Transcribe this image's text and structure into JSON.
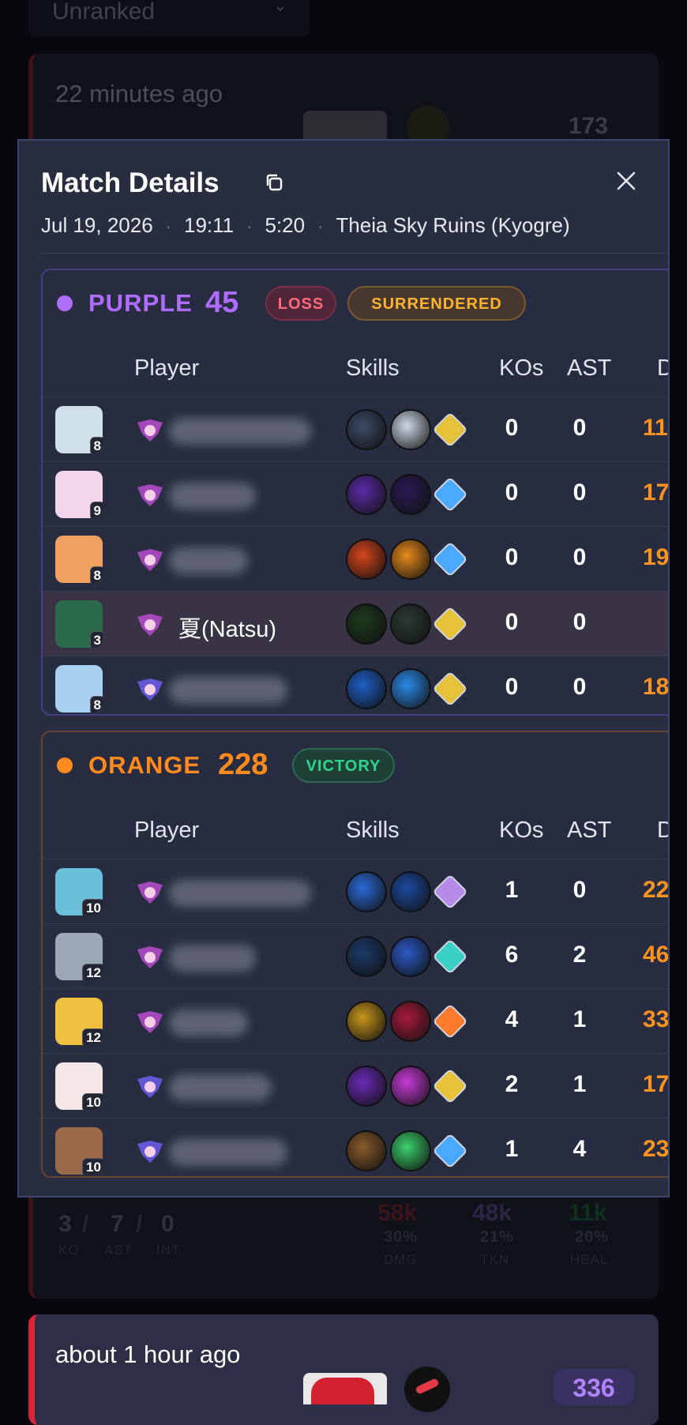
{
  "background": {
    "rank_filter": "Unranked",
    "card1": {
      "time_ago": "22 minutes ago",
      "score": "173",
      "ko": "3",
      "ast": "7",
      "int": "0",
      "ko_label": "KO",
      "ast_label": "AST",
      "int_label": "INT",
      "dmg": "58k",
      "dmg_pct": "30%",
      "dmg_label": "DMG",
      "tkn": "48k",
      "tkn_pct": "21%",
      "tkn_label": "TKN",
      "heal": "11k",
      "heal_pct": "20%",
      "heal_label": "HEAL"
    },
    "card2": {
      "time_ago": "about 1 hour ago",
      "score": "336"
    }
  },
  "modal": {
    "title": "Match Details",
    "date": "Jul 19, 2026",
    "time": "19:11",
    "duration": "5:20",
    "map": "Theia Sky Ruins (Kyogre)",
    "col_player": "Player",
    "col_skills": "Skills",
    "col_kos": "KOs",
    "col_ast": "AST",
    "col_dmg": "D"
  },
  "teams": {
    "purple": {
      "name": "PURPLE",
      "score": "45",
      "result": "LOSS",
      "extra": "SURRENDERED",
      "color": "#b06cff",
      "players": [
        {
          "level": "8",
          "name": "",
          "kos": "0",
          "ast": "0",
          "dmg": "11"
        },
        {
          "level": "9",
          "name": "",
          "kos": "0",
          "ast": "0",
          "dmg": "17"
        },
        {
          "level": "8",
          "name": "",
          "kos": "0",
          "ast": "0",
          "dmg": "19"
        },
        {
          "level": "3",
          "name": "夏(Natsu)",
          "kos": "0",
          "ast": "0",
          "dmg": ""
        },
        {
          "level": "8",
          "name": "",
          "kos": "0",
          "ast": "0",
          "dmg": "18"
        }
      ]
    },
    "orange": {
      "name": "ORANGE",
      "score": "228",
      "result": "VICTORY",
      "color": "#ff8a1e",
      "players": [
        {
          "level": "10",
          "name": "",
          "kos": "1",
          "ast": "0",
          "dmg": "22"
        },
        {
          "level": "12",
          "name": "",
          "kos": "6",
          "ast": "2",
          "dmg": "46"
        },
        {
          "level": "12",
          "name": "",
          "kos": "4",
          "ast": "1",
          "dmg": "33"
        },
        {
          "level": "10",
          "name": "",
          "kos": "2",
          "ast": "1",
          "dmg": "17"
        },
        {
          "level": "10",
          "name": "",
          "kos": "1",
          "ast": "4",
          "dmg": "23"
        }
      ]
    }
  },
  "icons": {
    "copy": "copy-icon",
    "close": "close-icon",
    "dropdown": "chevron-down-icon"
  }
}
